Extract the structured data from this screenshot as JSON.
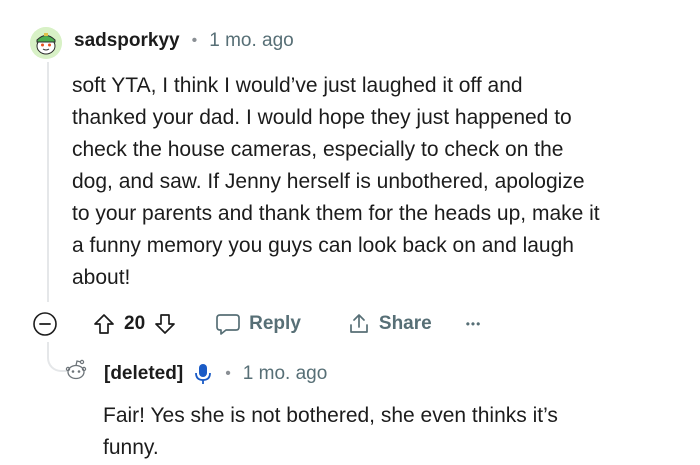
{
  "comment": {
    "username": "sadsporkyy",
    "separator": "•",
    "time": "1 mo. ago",
    "lines": [
      "soft YTA, I think I would’ve just laughed it off and",
      "thanked your dad. I would hope they just happened to",
      "check the house cameras, especially to check on the",
      "dog, and saw. If Jenny herself is unbothered, apologize",
      "to your parents and thank them for the heads up, make it",
      "a funny memory you guys can look back on and laugh",
      "about!"
    ],
    "votes": "20",
    "reply_label": "Reply",
    "share_label": "Share",
    "more_label": "•••"
  },
  "reply": {
    "username": "[deleted]",
    "separator": "•",
    "time": "1 mo. ago",
    "lines": [
      "Fair! Yes she is not bothered, she even thinks it’s",
      "funny."
    ]
  },
  "colors": {
    "text": "#1c1c1c",
    "meta": "#576f76",
    "thread_line": "#e5e7e9",
    "mic_icon": "#1a5bc6"
  }
}
